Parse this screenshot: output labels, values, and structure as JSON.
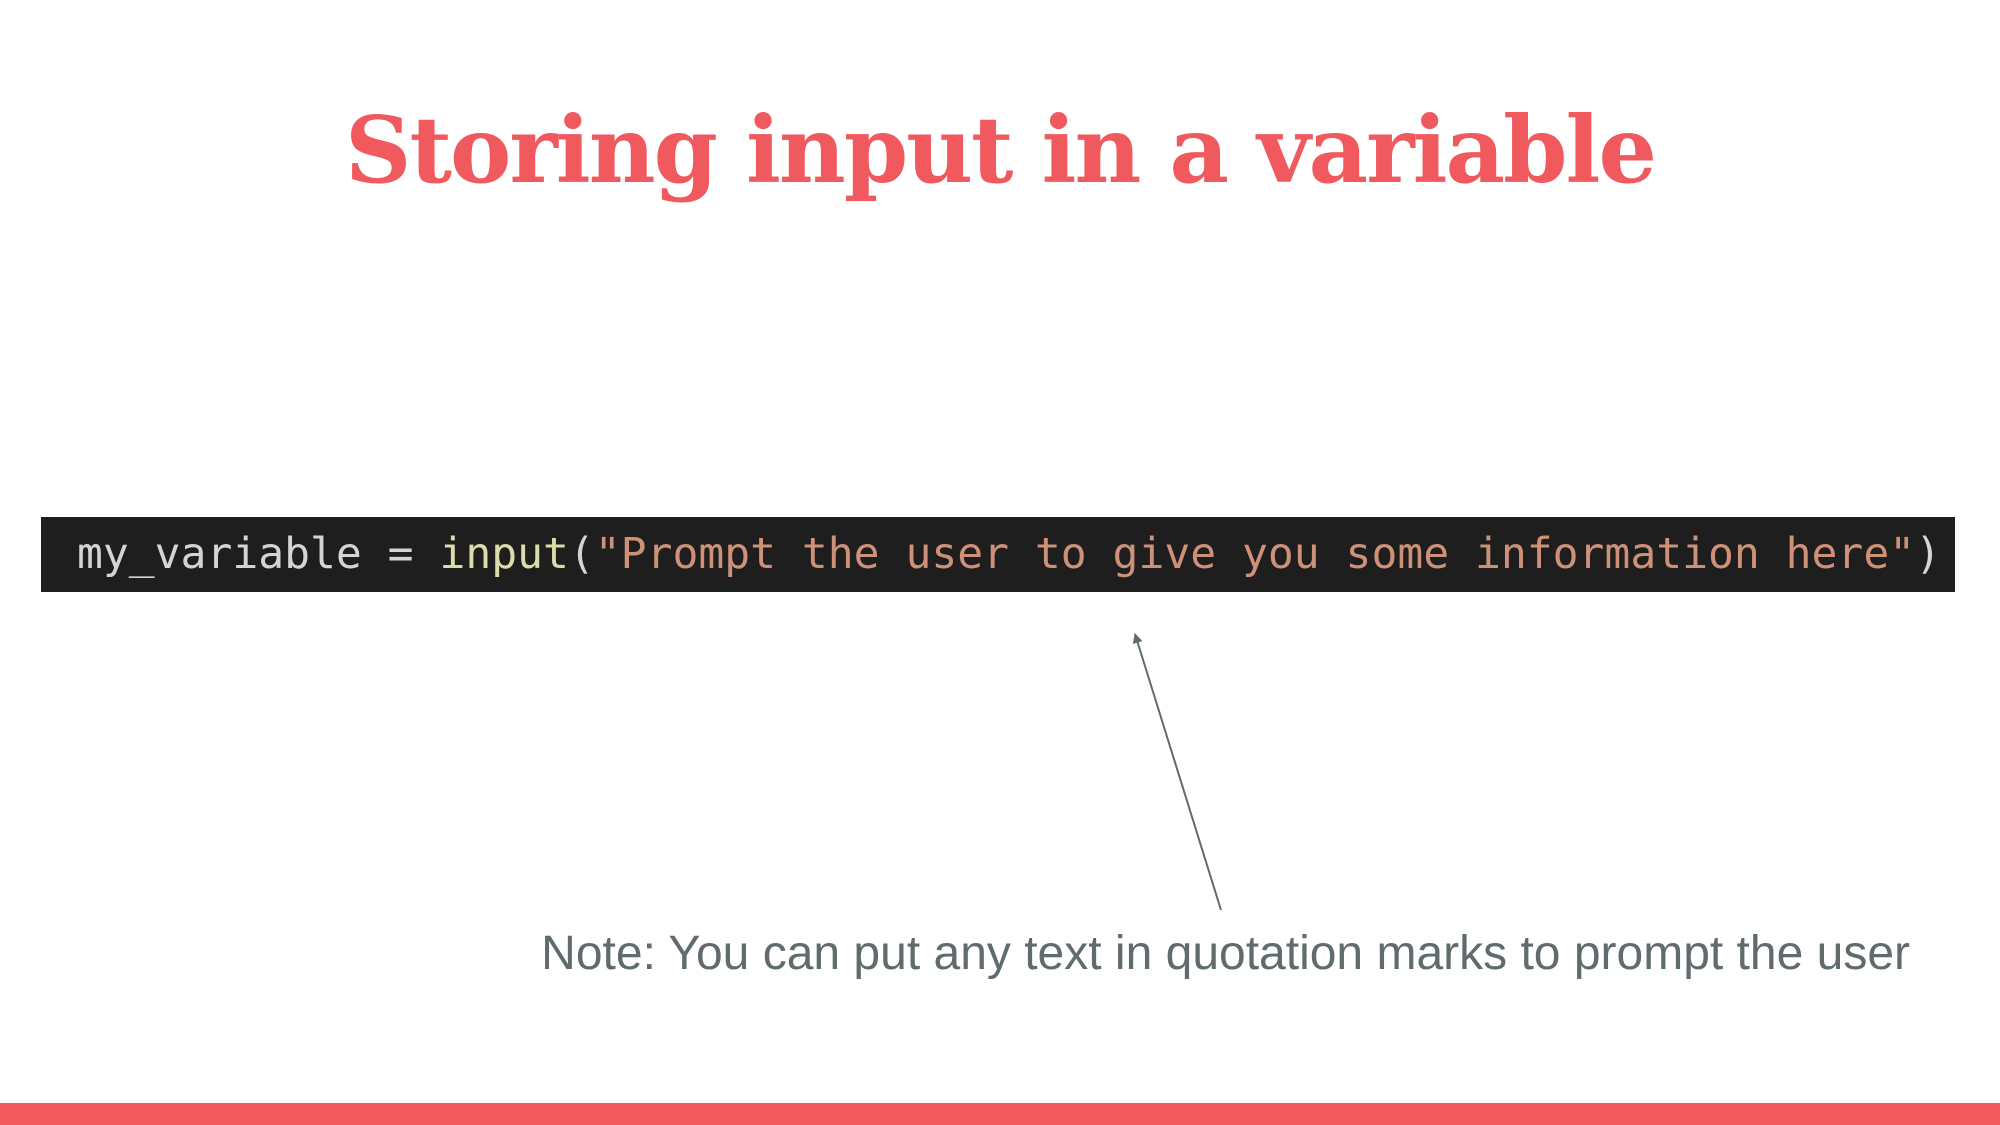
{
  "slide": {
    "title": "Storing input in a variable",
    "code": {
      "variable": "my_variable",
      "operator": " = ",
      "function": "input",
      "open_paren": "(",
      "string": "\"Prompt the user to give you some information here\"",
      "close_paren": ")"
    },
    "note": "Note: You can put any text in quotation marks to prompt the user"
  },
  "colors": {
    "accent": "#f05a5f",
    "code_background": "#1e1e1e",
    "code_text": "#d4d4d4",
    "code_function": "#dcdcaa",
    "code_string": "#ce9178",
    "note_text": "#5f6b6d"
  }
}
